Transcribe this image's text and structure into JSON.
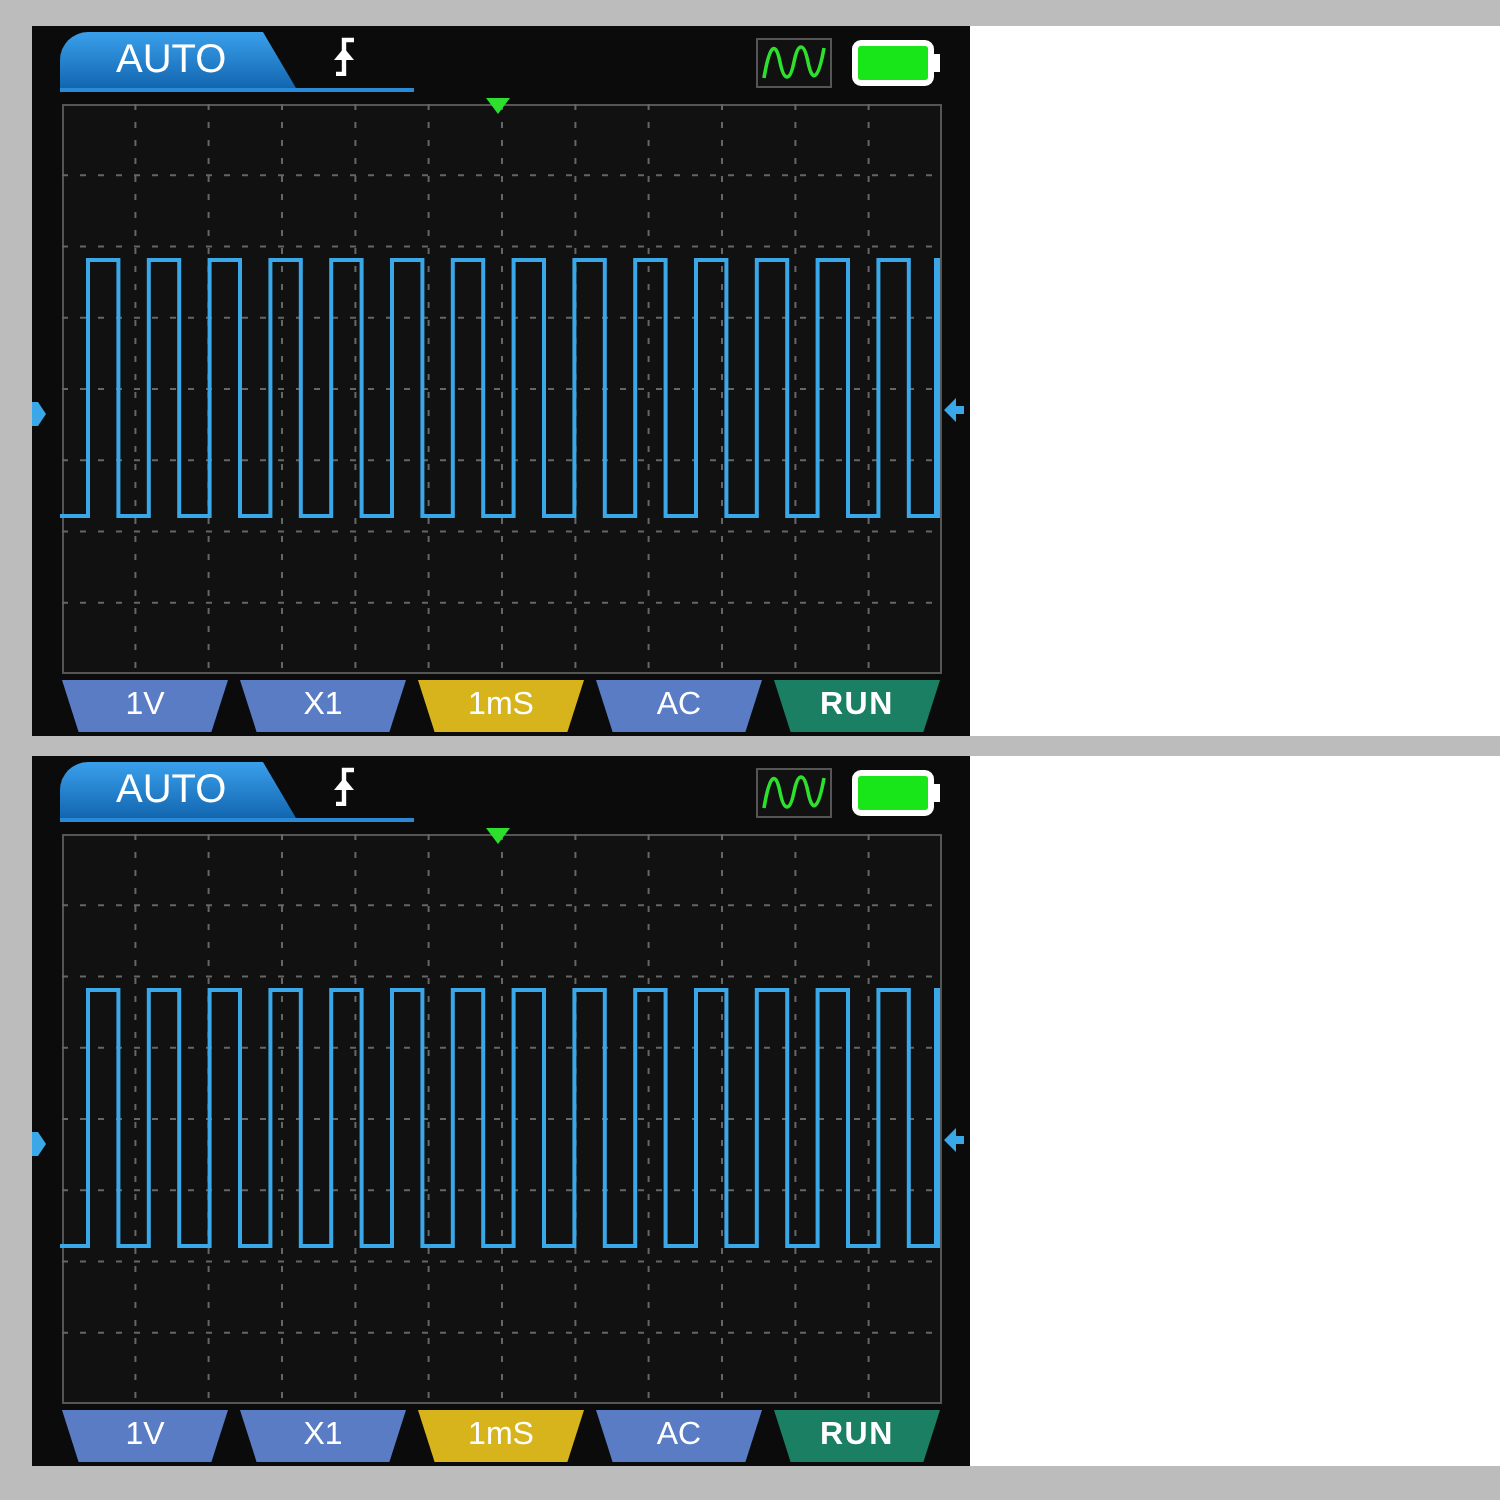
{
  "screens": [
    {
      "mode": "AUTO",
      "buttons": [
        {
          "label": "1V",
          "color": "#5a7cc4"
        },
        {
          "label": "X1",
          "color": "#5a7cc4"
        },
        {
          "label": "1mS",
          "color": "#d8b41c"
        },
        {
          "label": "AC",
          "color": "#5a7cc4"
        },
        {
          "label": "RUN",
          "color": "#1b7f63"
        }
      ]
    },
    {
      "mode": "AUTO",
      "buttons": [
        {
          "label": "1V",
          "color": "#5a7cc4"
        },
        {
          "label": "X1",
          "color": "#5a7cc4"
        },
        {
          "label": "1mS",
          "color": "#d8b41c"
        },
        {
          "label": "AC",
          "color": "#5a7cc4"
        },
        {
          "label": "RUN",
          "color": "#1b7f63"
        }
      ]
    }
  ]
}
